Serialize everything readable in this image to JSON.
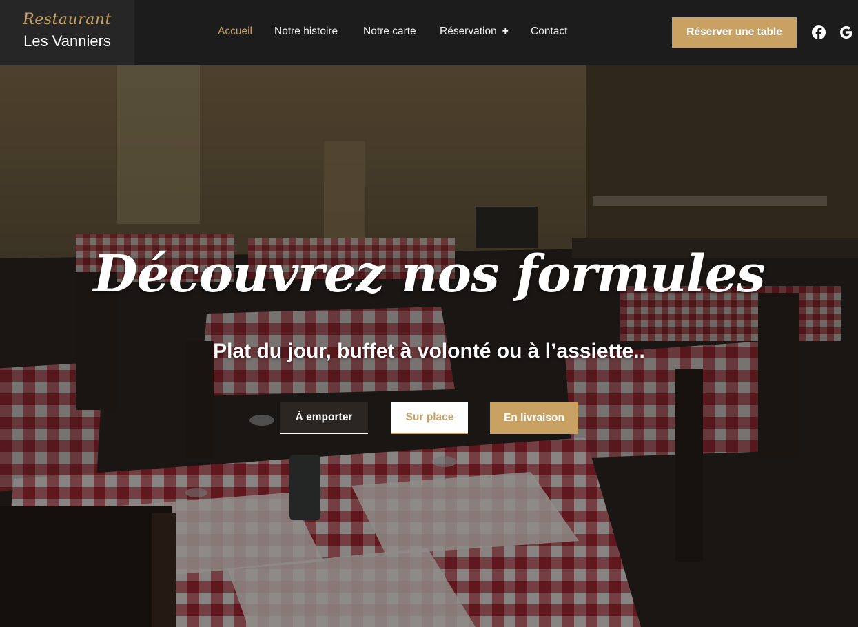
{
  "logo": {
    "script": "Restaurant",
    "name": "Les Vanniers"
  },
  "nav": {
    "items": [
      {
        "label": "Accueil",
        "active": true
      },
      {
        "label": "Notre histoire",
        "active": false
      },
      {
        "label": "Notre carte",
        "active": false
      },
      {
        "label": "Réservation",
        "active": false,
        "has_submenu": true
      },
      {
        "label": "Contact",
        "active": false
      }
    ],
    "submenu_indicator": "+"
  },
  "header": {
    "cta_label": "Réserver une table",
    "social": [
      "facebook-icon",
      "google-icon"
    ]
  },
  "hero": {
    "title": "Découvrez nos formules",
    "subtitle": "Plat du jour, buffet à volonté ou à l’assiette..",
    "buttons": {
      "emporter": "À emporter",
      "surplace": "Sur place",
      "livraison": "En livraison"
    }
  },
  "colors": {
    "accent": "#c9a263",
    "header_bg": "#1c1c1c",
    "logo_bg": "#262626",
    "tablecloth_red": "#a8343c"
  }
}
